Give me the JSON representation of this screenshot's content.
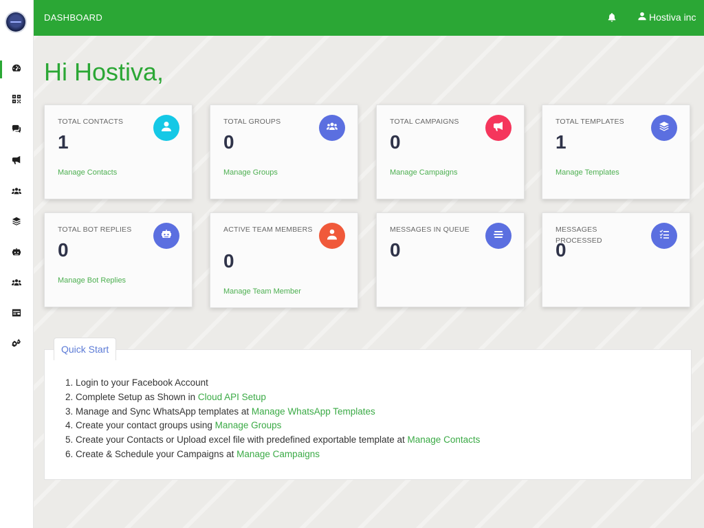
{
  "topbar": {
    "title": "DASHBOARD",
    "user_name": "Hostiva inc"
  },
  "greeting": "Hi Hostiva,",
  "cards": [
    {
      "label": "TOTAL CONTACTS",
      "value": "1",
      "link": "Manage Contacts",
      "icon": "user-icon",
      "color": "#14c8e6"
    },
    {
      "label": "TOTAL GROUPS",
      "value": "0",
      "link": "Manage Groups",
      "icon": "users-icon",
      "color": "#5b6fe0"
    },
    {
      "label": "TOTAL CAMPAIGNS",
      "value": "0",
      "link": "Manage Campaigns",
      "icon": "megaphone-icon",
      "color": "#f5365c"
    },
    {
      "label": "TOTAL TEMPLATES",
      "value": "1",
      "link": "Manage Templates",
      "icon": "layers-icon",
      "color": "#5b6fe0"
    },
    {
      "label": "TOTAL BOT REPLIES",
      "value": "0",
      "link": "Manage Bot Replies",
      "icon": "robot-icon",
      "color": "#5b6fe0"
    },
    {
      "label": "ACTIVE TEAM MEMBERS",
      "value": "0",
      "link": "Manage Team Member",
      "icon": "team-member-icon",
      "color": "#f0593a"
    },
    {
      "label": "MESSAGES IN QUEUE",
      "value": "0",
      "link": "",
      "icon": "queue-icon",
      "color": "#5b6fe0"
    },
    {
      "label": "MESSAGES PROCESSED",
      "value": "0",
      "link": "",
      "icon": "checklist-icon",
      "color": "#5b6fe0"
    }
  ],
  "quick_start": {
    "tab_label": "Quick Start",
    "steps": [
      {
        "text": "1. Login to your Facebook Account",
        "link": ""
      },
      {
        "text": "2. Complete Setup as Shown in ",
        "link": "Cloud API Setup"
      },
      {
        "text": "3. Manage and Sync WhatsApp templates at ",
        "link": "Manage WhatsApp Templates"
      },
      {
        "text": "4. Create your contact groups using ",
        "link": "Manage Groups"
      },
      {
        "text": "5. Create your Contacts or Upload excel file with predefined exportable template at ",
        "link": "Manage Contacts"
      },
      {
        "text": "6. Create & Schedule your Campaigns at ",
        "link": "Manage Campaigns"
      }
    ]
  },
  "colors": {
    "brand_green": "#2ba735",
    "link_green": "#4caf50",
    "value_dark": "#2f3349"
  }
}
